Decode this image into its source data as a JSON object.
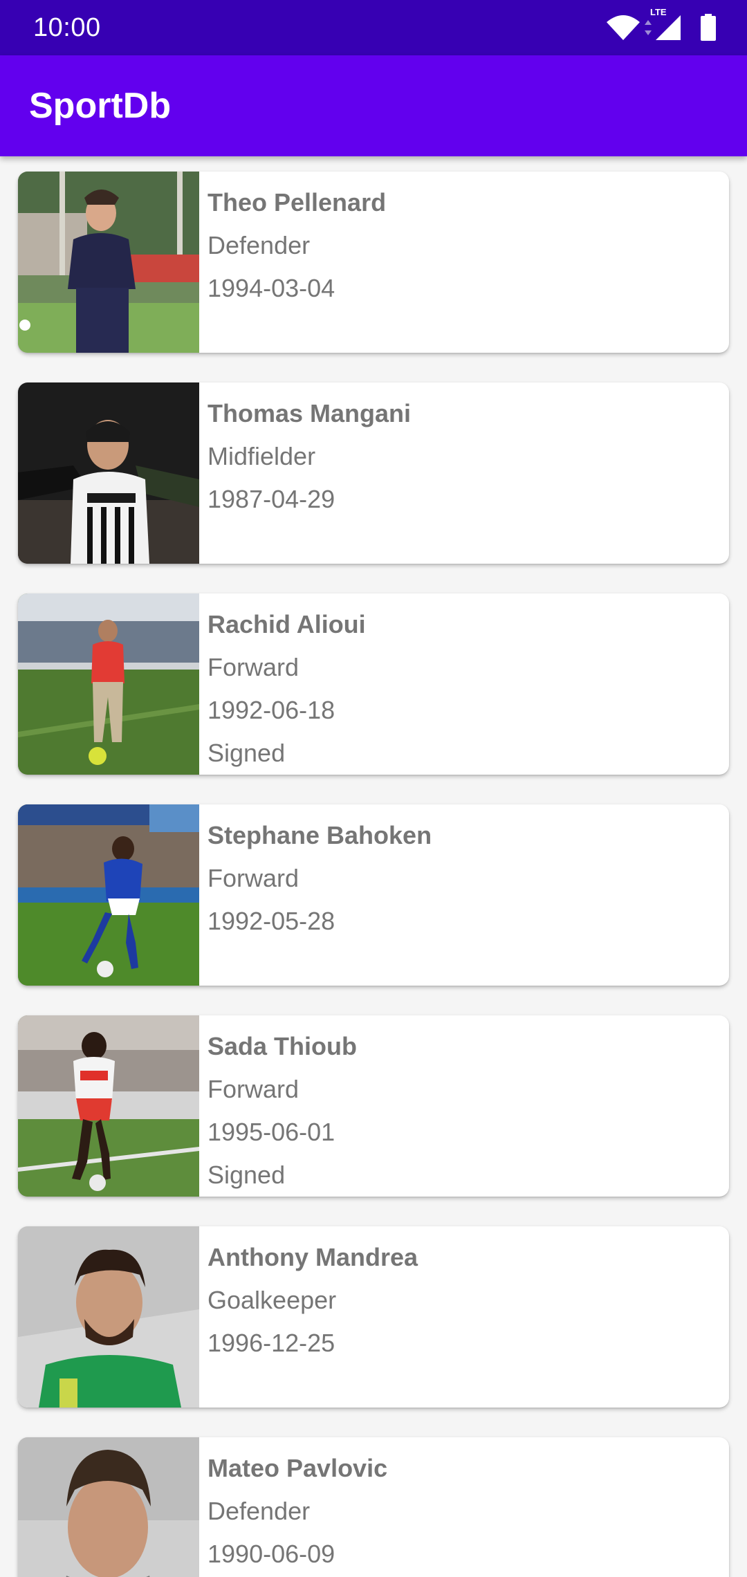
{
  "status_bar": {
    "time": "10:00",
    "network_label": "LTE",
    "icons": [
      "wifi-icon",
      "signal-icon",
      "battery-icon"
    ]
  },
  "app_bar": {
    "title": "SportDb"
  },
  "colors": {
    "status_bar": "#3700b3",
    "app_bar": "#6200ee",
    "card": "#ffffff",
    "text": "#757575",
    "background": "#f5f5f5"
  },
  "players": [
    {
      "name": "Theo Pellenard",
      "position": "Defender",
      "birthdate": "1994-03-04",
      "status": ""
    },
    {
      "name": "Thomas Mangani",
      "position": "Midfielder",
      "birthdate": "1987-04-29",
      "status": ""
    },
    {
      "name": "Rachid Alioui",
      "position": "Forward",
      "birthdate": "1992-06-18",
      "status": "Signed"
    },
    {
      "name": "Stephane Bahoken",
      "position": "Forward",
      "birthdate": "1992-05-28",
      "status": ""
    },
    {
      "name": "Sada Thioub",
      "position": "Forward",
      "birthdate": "1995-06-01",
      "status": "Signed"
    },
    {
      "name": "Anthony Mandrea",
      "position": "Goalkeeper",
      "birthdate": "1996-12-25",
      "status": ""
    },
    {
      "name": "Mateo Pavlovic",
      "position": "Defender",
      "birthdate": "1990-06-09",
      "status": ""
    }
  ]
}
